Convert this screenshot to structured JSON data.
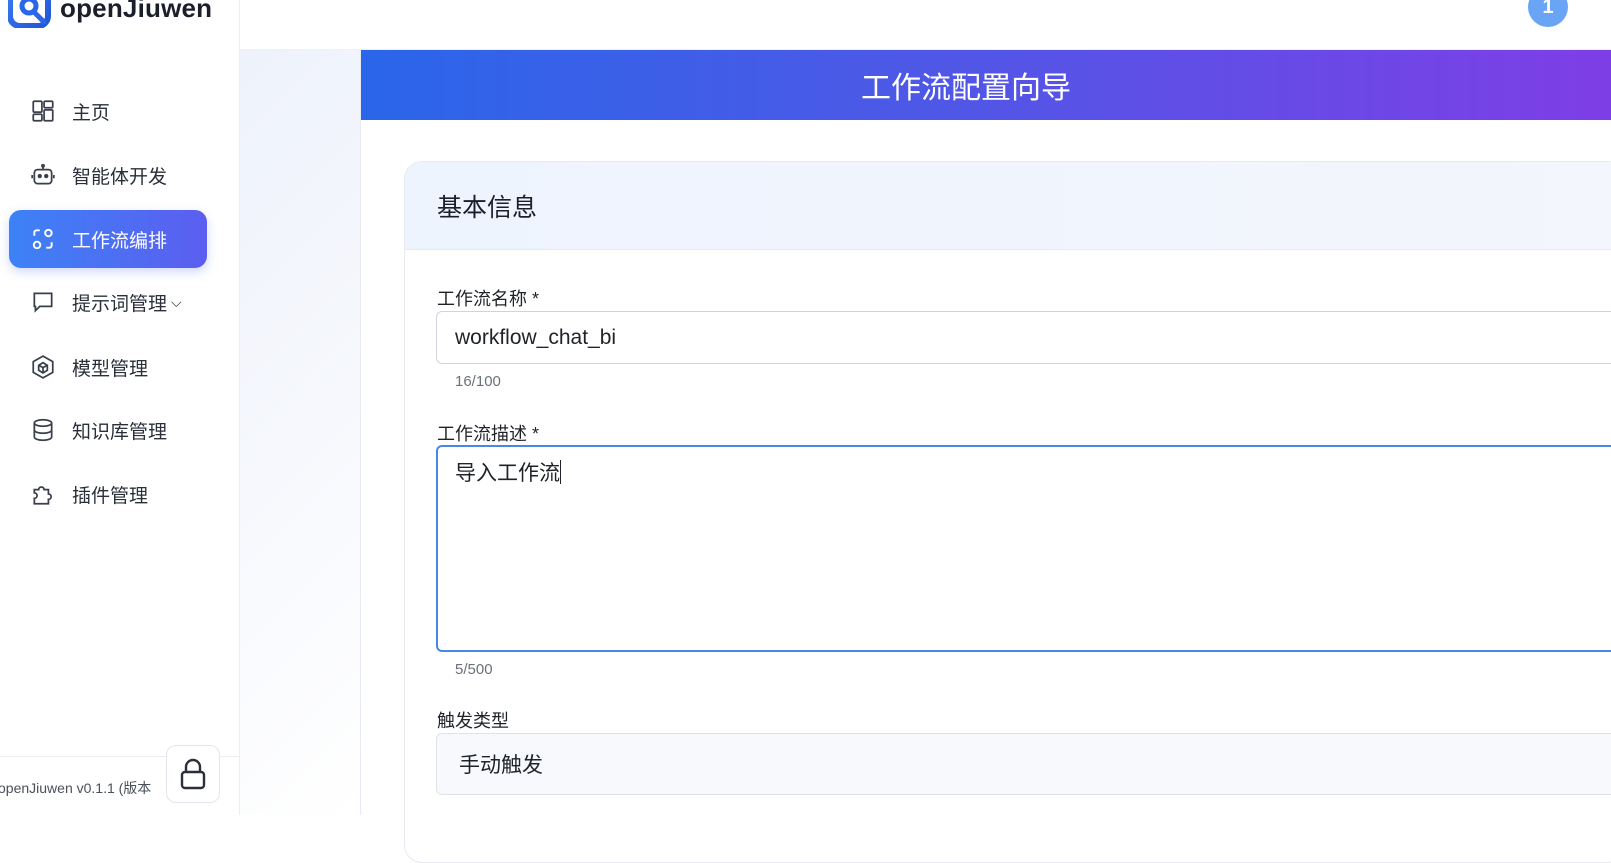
{
  "app": {
    "name": "openJiuwen",
    "version_text": "openJiuwen v0.1.1 (版本"
  },
  "user": {
    "avatar_text": "1"
  },
  "sidebar": {
    "items": [
      {
        "label": "主页",
        "icon": "dashboard-icon",
        "active": false
      },
      {
        "label": "智能体开发",
        "icon": "robot-icon",
        "active": false
      },
      {
        "label": "工作流编排",
        "icon": "workflow-icon",
        "active": true
      },
      {
        "label": "提示词管理",
        "icon": "chat-bubble-icon",
        "active": false,
        "has_submenu": true
      },
      {
        "label": "模型管理",
        "icon": "cube-icon",
        "active": false
      },
      {
        "label": "知识库管理",
        "icon": "database-icon",
        "active": false
      },
      {
        "label": "插件管理",
        "icon": "puzzle-icon",
        "active": false
      }
    ],
    "submenu_chevron": "⌵"
  },
  "wizard": {
    "title": "工作流配置向导",
    "section_title": "基本信息",
    "name_label": "工作流名称 *",
    "name_value": "workflow_chat_bi",
    "name_counter": "16/100",
    "desc_label": "工作流描述 *",
    "desc_value": "导入工作流",
    "desc_counter": "5/500",
    "trigger_label": "触发类型",
    "trigger_value": "手动触发"
  },
  "colors": {
    "accent_blue": "#3d82f6",
    "accent_purple": "#7e3ee6",
    "focus_border": "#4a86e8"
  }
}
